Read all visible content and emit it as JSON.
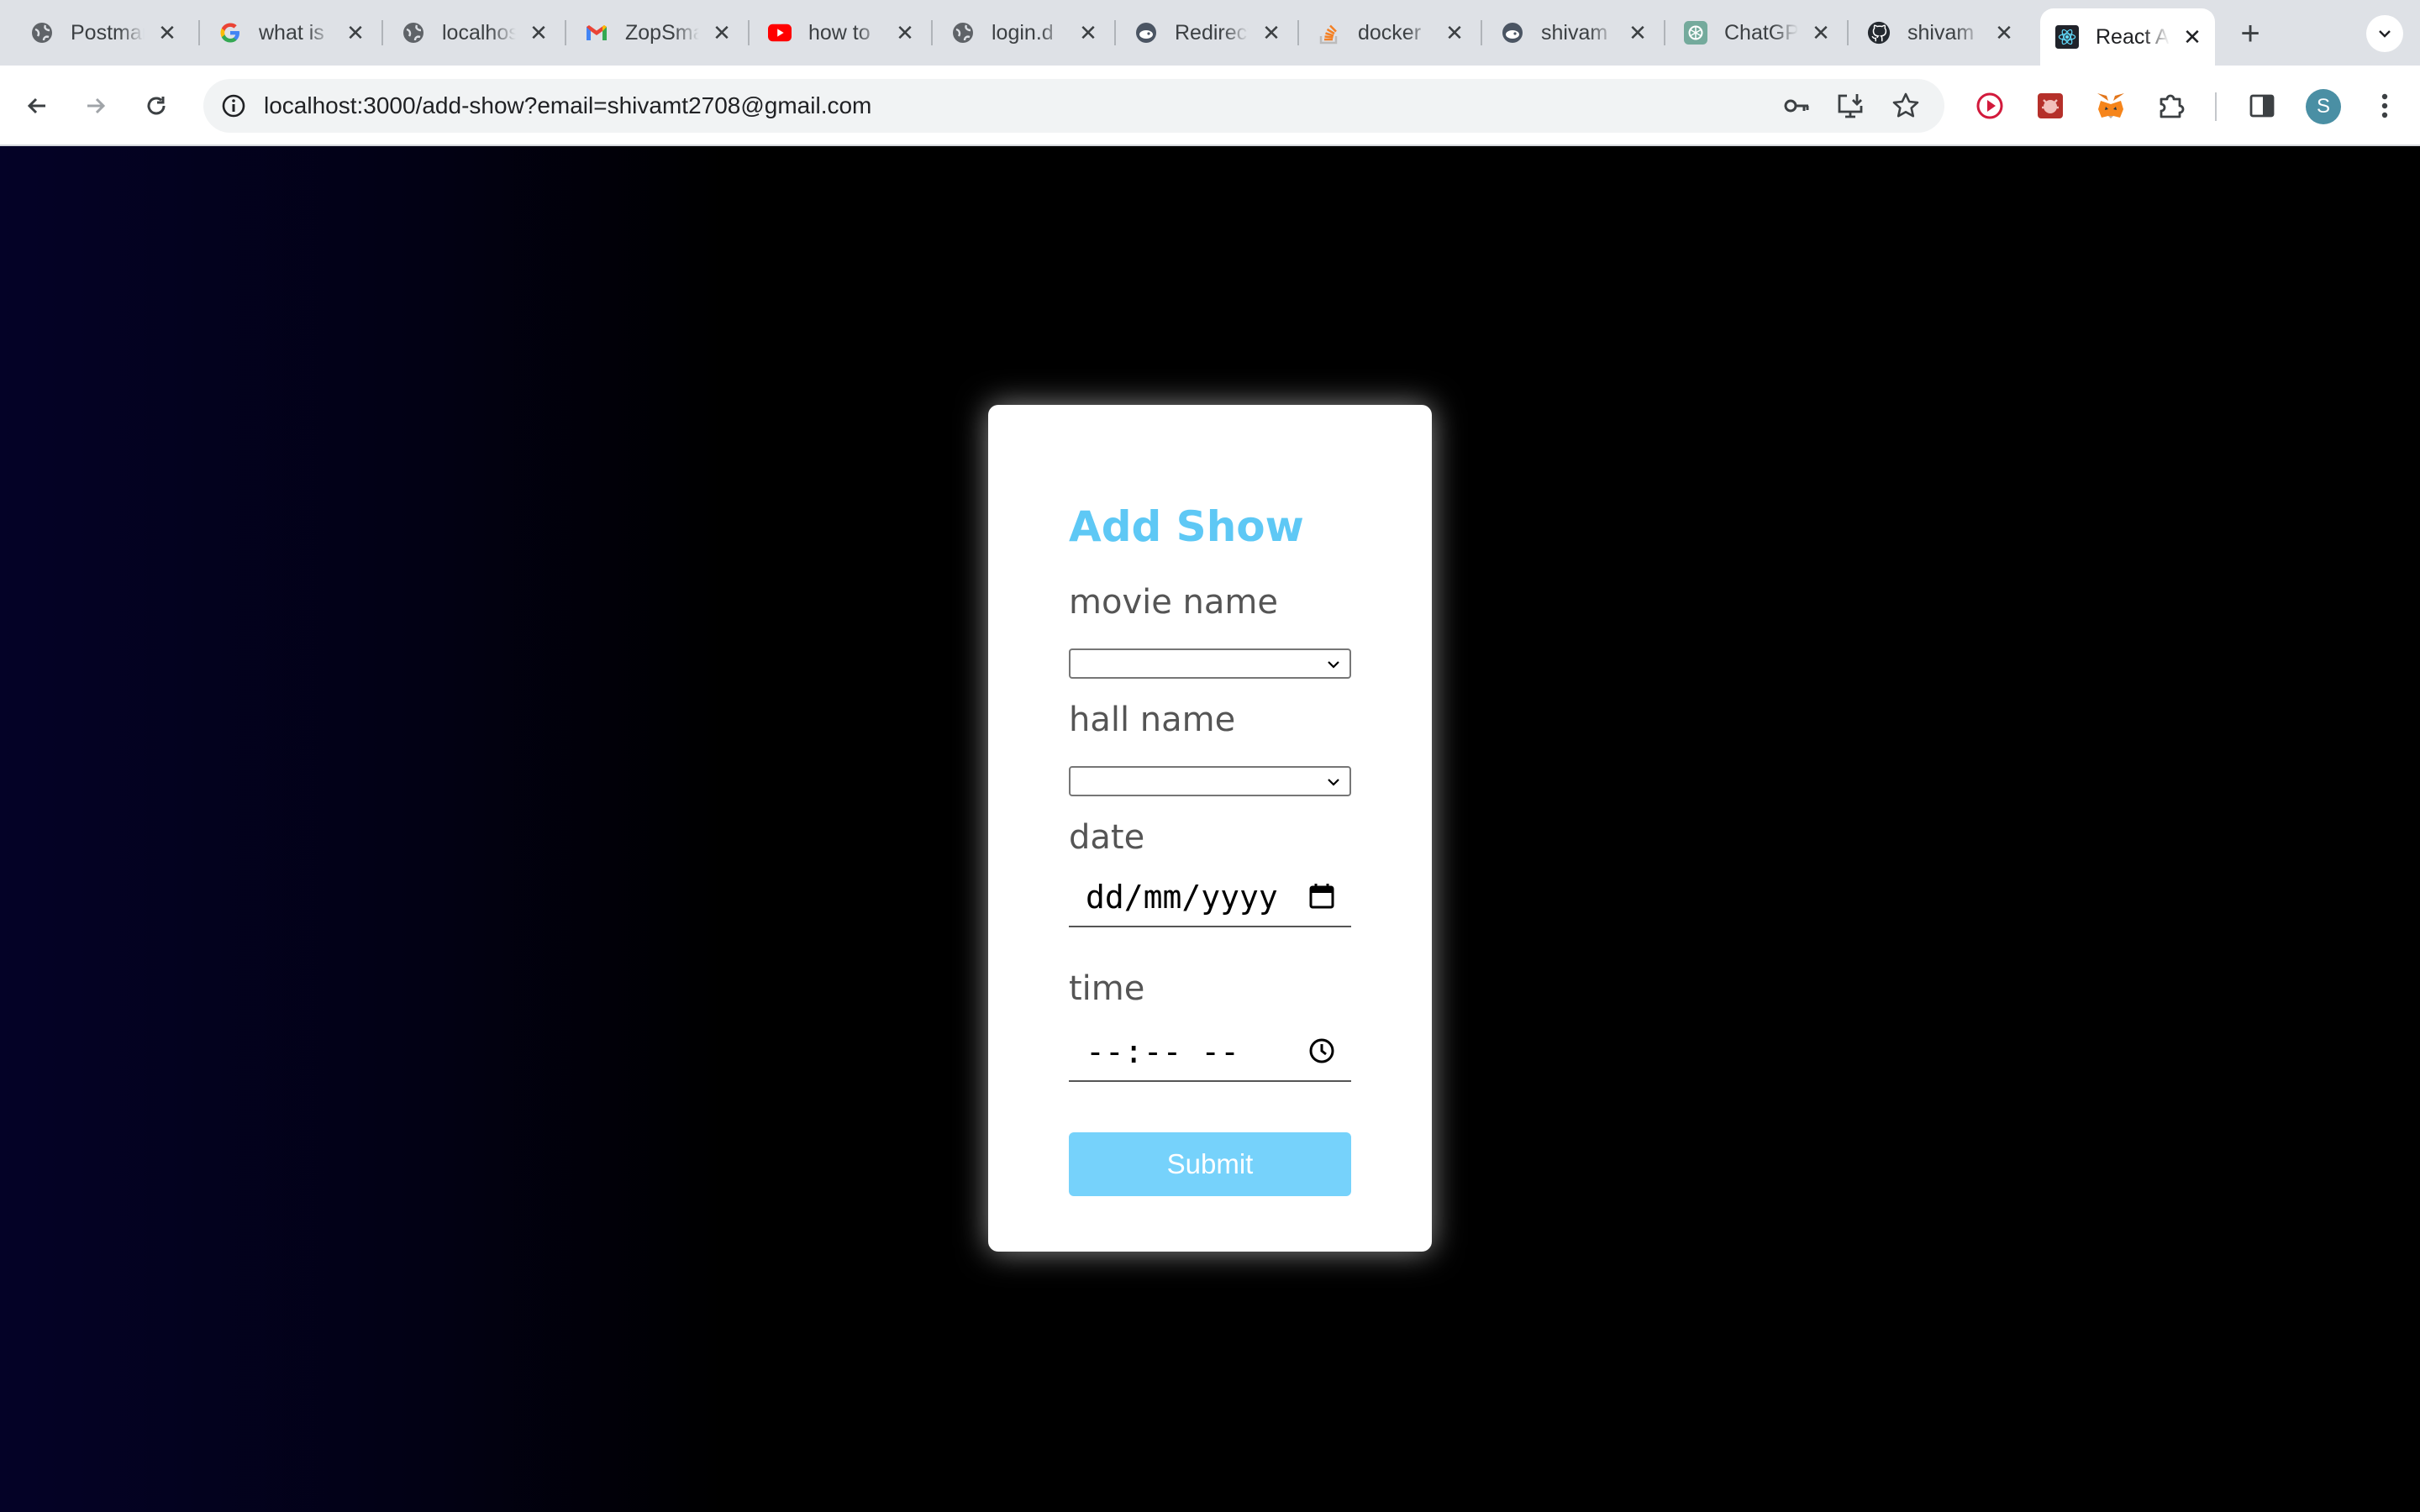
{
  "tabs": [
    {
      "title": "Postman",
      "icon": "globe-icon",
      "active": false
    },
    {
      "title": "what is",
      "icon": "google-icon",
      "active": false
    },
    {
      "title": "localhost",
      "icon": "globe-icon",
      "active": false
    },
    {
      "title": "ZopSmart",
      "icon": "gmail-icon",
      "active": false
    },
    {
      "title": "how to",
      "icon": "youtube-icon",
      "active": false
    },
    {
      "title": "login.d",
      "icon": "globe-icon",
      "active": false
    },
    {
      "title": "Redirect",
      "icon": "docker-icon",
      "active": false
    },
    {
      "title": "docker",
      "icon": "stackoverflow-icon",
      "active": false
    },
    {
      "title": "shivam",
      "icon": "docker-icon",
      "active": false
    },
    {
      "title": "ChatGPT",
      "icon": "chatgpt-icon",
      "active": false
    },
    {
      "title": "shivam",
      "icon": "github-icon",
      "active": false
    },
    {
      "title": "React App",
      "icon": "react-icon",
      "active": true
    }
  ],
  "address_bar": {
    "url": "localhost:3000/add-show?email=shivamt2708@gmail.com"
  },
  "profile": {
    "initial": "S"
  },
  "form": {
    "title": "Add Show",
    "movie_label": "movie name",
    "movie_value": "",
    "hall_label": "hall name",
    "hall_value": "",
    "date_label": "date",
    "date_placeholder": "dd/mm/yyyy",
    "time_label": "time",
    "time_placeholder": "--:-- --",
    "submit_label": "Submit"
  },
  "colors": {
    "accent": "#5ec8f5",
    "submit_bg": "#76d2fb",
    "page_bg": "#000000",
    "page_bg_left": "#040227"
  }
}
